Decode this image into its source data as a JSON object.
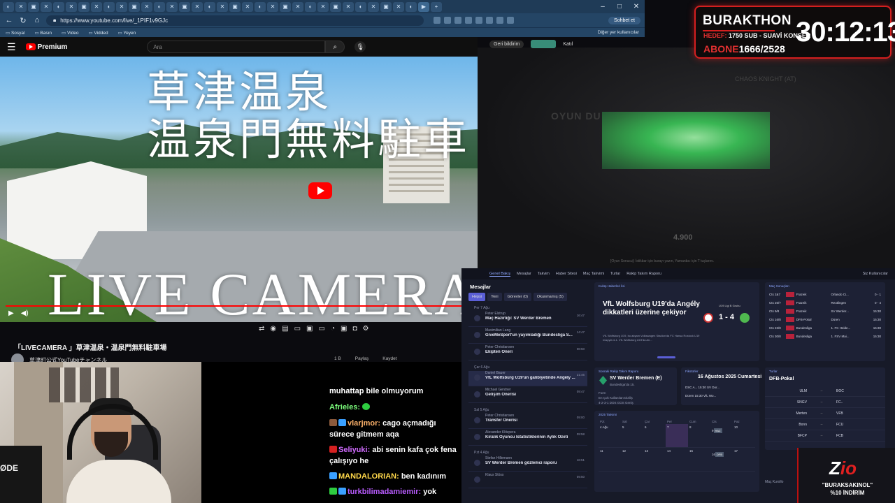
{
  "browser": {
    "url": "https://www.youtube.com/live/_1PIF1v9GJc",
    "sohbet": "Sohbet et",
    "bookmarks": [
      "Sosyal",
      "Basın",
      "Video",
      "Vidded",
      "Yeyen"
    ],
    "bookmarks_right": "Diğer yer kullanıcılar"
  },
  "youtube": {
    "logo": "Premium",
    "search_placeholder": "Ara",
    "video_title_jp_line1": "草津温泉",
    "video_title_jp_line2": "温泉門無料駐車",
    "video_live_text": "LIVE CAMERA",
    "title": "「LIVECAMERA 」草津温泉・温泉門無料駐車場",
    "channel": "草津町公式YouTubeチャンネル",
    "actions": [
      "1 B",
      "Paylaş",
      "Kaydet"
    ],
    "feedback": "Geri bildirim",
    "join": "Katıl",
    "progress": 0.98
  },
  "game": {
    "label": "OYUN DU",
    "enemy": "CHAOS KNIGHT (AT)",
    "score": "4.900",
    "footer": "[Oyun Sonucu]: İstikbar için burayı yazın, Yamanba: için T tuşlarını."
  },
  "timer": {
    "title": "BURAKTHON",
    "hedef_label": "HEDEF:",
    "hedef_value": "1750 SUB - SUAVİ KONSER",
    "abone_label": "ABONE",
    "abone_value": "1666/2528",
    "clock": "30:12:13"
  },
  "webcam": {
    "label": "ØDE"
  },
  "chat": {
    "messages": [
      {
        "user": "",
        "text": "muhattap bile olmuyorum",
        "color": "#ffffff"
      },
      {
        "user": "Afrieles:",
        "text": "",
        "color": "#7dff7d"
      },
      {
        "user": "vlarjmor:",
        "text": "cago açmadığı",
        "color": "#ffb36b",
        "cont": "sürece gitmem aqa"
      },
      {
        "user": "Seliyuki:",
        "text": "abi senin kafa çok fena",
        "color": "#d16bff",
        "cont": "çalışıyo he"
      },
      {
        "user": "MANDALORIAN:",
        "text": "ben kadınım",
        "color": "#ffd84a"
      },
      {
        "user": "turkbilimadamiemir:",
        "text": "yok",
        "color": "#b95cff"
      }
    ]
  },
  "fm": {
    "nav": [
      "Genel Bakış",
      "Mesajlar",
      "Takvim",
      "Haber Sitesi",
      "Maç Takvimi",
      "Turlar",
      "Rakip Takım Raporu"
    ],
    "nav_right": "Siz Kullanıcılar",
    "inbox_title": "Mesajlar",
    "filters": [
      "Hepsi",
      "Yeni",
      "Görevler (0)",
      "Okunmamış (5)"
    ],
    "messages": [
      {
        "day": "Per 7 Ağu",
        "from": "Peter Elstrup",
        "subject": "Maç Hazırlığı: SV Werder Bremen",
        "time": "16:47"
      },
      {
        "day": "",
        "from": "Maximilian Lang",
        "subject": "GiveMeSport'un yayımladığı Bundesliga S...",
        "time": "14:47"
      },
      {
        "day": "",
        "from": "Peter Christiansen",
        "subject": "Ekipten Öneri",
        "time": "08:50"
      },
      {
        "day": "Çar 6 Ağu",
        "from": "Daniel Bauer",
        "subject": "VfL Wolfsburg U19'un galibiyetinde Angély ...",
        "time": "21:46"
      },
      {
        "day": "",
        "from": "Michael Gentner",
        "subject": "Gelişim Önerisi",
        "time": "09:47"
      },
      {
        "day": "Sal 5 Ağu",
        "from": "Peter Christiansen",
        "subject": "Transfer Önerisi",
        "time": "09:00"
      },
      {
        "day": "",
        "from": "Alexander Klitzpera",
        "subject": "Kiralık Oyuncu İstatistiklerinin Aylık Özeti",
        "time": "09:58"
      },
      {
        "day": "Pzt 4 Ağu",
        "from": "Stefan Hillemann",
        "subject": "SV Werder Bremen gözlemci raporu",
        "time": "16:51"
      },
      {
        "day": "",
        "from": "Klaus Stöss",
        "subject": "",
        "time": "09:50"
      }
    ],
    "news": {
      "header": "Kulüp Haberleri lisi",
      "headline": "VfL Wolfsburg U19'da Angély dikkatleri üzerine çekiyor",
      "body": "VfL Wolfsburg U19, bu akşam Volkswagen Stadion'da FC Hansa Rostock U19 maçıyla 4-1. VfL Wolfsburg U19'da An...",
      "group": "U19 Ligi B Grubu",
      "score": "1 - 4"
    },
    "results": {
      "header": "Maç Sonuçları",
      "rows": [
        {
          "date": "Cts 2&7",
          "home": "Frazeik",
          "away": "Orlando Ci...",
          "score": "0 - 1"
        },
        {
          "date": "Cts 26/7",
          "home": "Frazeik",
          "away": "Reutlingen",
          "score": "0 - 4"
        },
        {
          "date": "Cts 9/8",
          "home": "Frazeik",
          "away": "SV Werder...",
          "score": "15:30"
        },
        {
          "date": "Cts 16/8",
          "home": "DFB-Pokal",
          "away": "Düren",
          "score": "15:30"
        },
        {
          "date": "Cts 23/8",
          "home": "Bundesliga",
          "away": "1. FC Heide...",
          "score": "15:30"
        },
        {
          "date": "Cts 30/8",
          "home": "Bundesliga",
          "away": "1. FSV Mai...",
          "score": "15:30"
        }
      ]
    },
    "next_opponent": {
      "header": "Sonraki Rakip Takım Raporu",
      "team": "SV Werder Bremen (E)",
      "sub": "Bundesliga'da 15.",
      "form_label": "Form",
      "manager": "En Çok Kullanılan Diziliş",
      "formation": "4-2-3-1 DOS GOS Geniş"
    },
    "fixtures": {
      "header": "Fikstürler",
      "date": "16 Ağustos 2025 Cumartesi",
      "line1": "DSC A...  15:30  SV Dor...",
      "line2": "Düren  15:30  VfL Wo..."
    },
    "calendar": {
      "header": "2025 Takvimi",
      "days": [
        "Pzt",
        "Sal",
        "Çar",
        "Per",
        "Cum",
        "Cts",
        "Paz"
      ],
      "week1": [
        "4 Ağu",
        "5",
        "6",
        "7",
        "8",
        "9",
        "10"
      ],
      "week2": [
        "11",
        "12",
        "13",
        "14",
        "15",
        "16",
        "17"
      ],
      "ev1": "HAZ",
      "ev2": "DFB"
    },
    "cup": {
      "header": "Turlar",
      "title": "DFB-Pokal",
      "rows": [
        {
          "home": "ULM",
          "away": "BOC"
        },
        {
          "home": "SNGV",
          "away": "FC.."
        },
        {
          "home": "Merten",
          "away": "VFB"
        },
        {
          "home": "Bonn",
          "away": "FCU"
        },
        {
          "home": "BFCP",
          "away": "FCB"
        }
      ]
    },
    "footer": "Maç Kurollo"
  },
  "promo": {
    "brand": "Z",
    "brand_rest": "io",
    "code": "\"BURAKSAKINOL\"",
    "discount": "%10 İNDİRİM"
  }
}
